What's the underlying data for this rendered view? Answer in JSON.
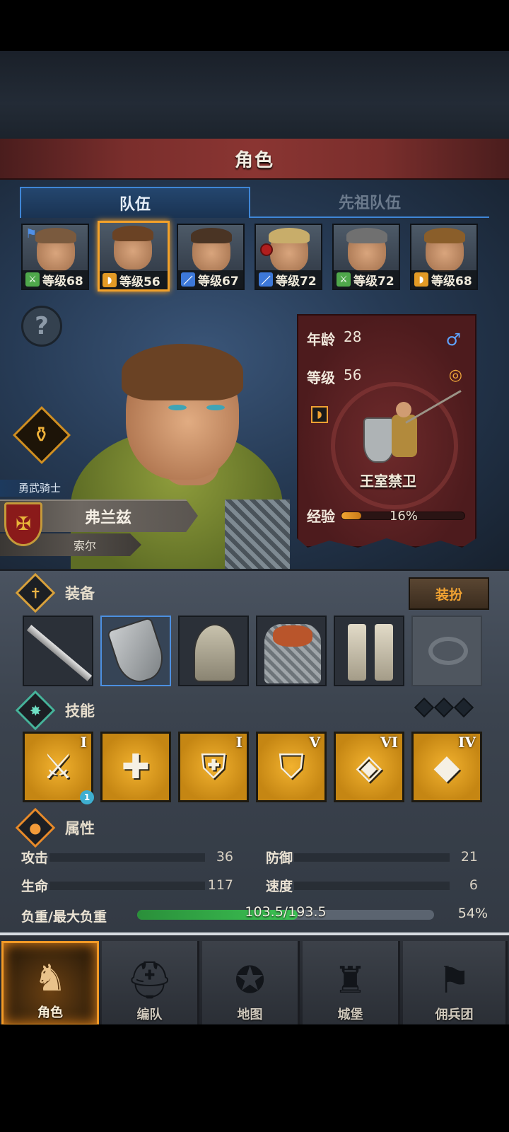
{
  "header": {
    "title": "角色"
  },
  "tabs": [
    {
      "label": "队伍",
      "active": true
    },
    {
      "label": "先祖队伍",
      "active": false
    }
  ],
  "party": [
    {
      "class_icon": "crossed-swords-icon",
      "class_color": "#4fa84b",
      "level": "等级68",
      "hair": "#7a5a3e",
      "flag": true
    },
    {
      "class_icon": "shield-icon",
      "class_color": "#e39a25",
      "level": "等级56",
      "hair": "#6a4224",
      "selected": true
    },
    {
      "class_icon": "sword-icon",
      "class_color": "#3d78d8",
      "level": "等级67",
      "hair": "#4a3424"
    },
    {
      "class_icon": "sword-icon",
      "class_color": "#3d78d8",
      "level": "等级72",
      "hair": "#c8ad6a",
      "gem": true
    },
    {
      "class_icon": "crossed-swords-icon",
      "class_color": "#4fa84b",
      "level": "等级72",
      "hair": "#707070"
    },
    {
      "class_icon": "shield-icon",
      "class_color": "#e39a25",
      "level": "等级68",
      "hair": "#8a5e2a"
    }
  ],
  "hero": {
    "title": "勇武骑士",
    "name": "弗兰兹",
    "surname": "索尔"
  },
  "info": {
    "age_label": "年龄",
    "age": "28",
    "level_label": "等级",
    "level": "56",
    "unit_name": "王室禁卫",
    "exp_label": "经验",
    "exp_pct": "16%",
    "exp_fraction": 0.16
  },
  "equipment": {
    "title": "装备",
    "dress_button": "装扮",
    "slots": [
      "sword",
      "shield",
      "helmet",
      "armor",
      "boots",
      "ring"
    ]
  },
  "skills": {
    "title": "技能",
    "items": [
      {
        "rank": "I",
        "badge": "1"
      },
      {
        "rank": ""
      },
      {
        "rank": "I"
      },
      {
        "rank": "V"
      },
      {
        "rank": "VI"
      },
      {
        "rank": "IV"
      }
    ]
  },
  "attributes": {
    "title": "属性",
    "attack_label": "攻击",
    "attack": "36",
    "defense_label": "防御",
    "defense": "21",
    "hp_label": "生命",
    "hp": "117",
    "speed_label": "速度",
    "speed": "6",
    "load_label": "负重/最大负重",
    "load_text": "103.5/193.5",
    "load_pct": "54%",
    "load_fraction": 0.54
  },
  "nav": [
    {
      "label": "角色",
      "active": true
    },
    {
      "label": "编队"
    },
    {
      "label": "地图"
    },
    {
      "label": "城堡"
    },
    {
      "label": "佣兵团"
    }
  ]
}
